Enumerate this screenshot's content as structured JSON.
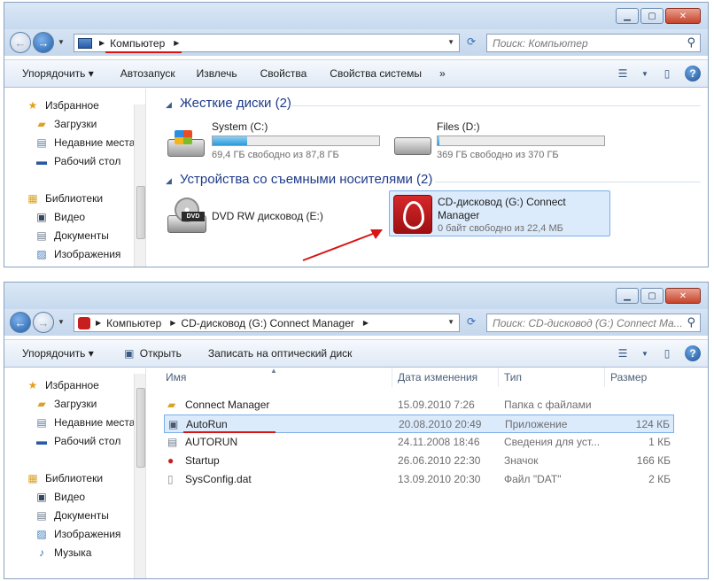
{
  "window1": {
    "address": {
      "crumbs": [
        "Компьютер"
      ]
    },
    "search_placeholder": "Поиск: Компьютер",
    "toolbar": {
      "organize": "Упорядочить ▾",
      "autorun": "Автозапуск",
      "eject": "Извлечь",
      "properties": "Свойства",
      "system_properties": "Свойства системы",
      "more": "»"
    },
    "sidebar": {
      "favorites": "Избранное",
      "downloads": "Загрузки",
      "recent": "Недавние места",
      "desktop": "Рабочий стол",
      "libraries": "Библиотеки",
      "video": "Видео",
      "documents": "Документы",
      "images": "Изображения"
    },
    "hard_drives": {
      "header": "Жесткие диски (2)",
      "items": [
        {
          "name": "System (C:)",
          "free": "69,4 ГБ свободно из 87,8 ГБ",
          "used_fraction": 0.21
        },
        {
          "name": "Files (D:)",
          "free": "369 ГБ свободно из 370 ГБ",
          "used_fraction": 0.003
        }
      ]
    },
    "removable": {
      "header": "Устройства со съемными носителями (2)",
      "dvd": {
        "name": "DVD RW дисковод (E:)"
      },
      "cd": {
        "name_line1": "CD-дисковод (G:) Connect",
        "name_line2": "Manager",
        "free": "0 байт свободно из 22,4 МБ"
      }
    },
    "dvd_icon_label": "DVD"
  },
  "window2": {
    "address": {
      "crumbs": [
        "Компьютер",
        "CD-дисковод (G:) Connect Manager"
      ]
    },
    "search_placeholder": "Поиск: CD-дисковод (G:) Connect Ma...",
    "toolbar": {
      "organize": "Упорядочить ▾",
      "open": "Открыть",
      "burn": "Записать на оптический диск"
    },
    "sidebar": {
      "favorites": "Избранное",
      "downloads": "Загрузки",
      "recent": "Недавние места",
      "desktop": "Рабочий стол",
      "libraries": "Библиотеки",
      "video": "Видео",
      "documents": "Документы",
      "images": "Изображения",
      "music": "Музыка"
    },
    "columns": {
      "name": "Имя",
      "date": "Дата изменения",
      "type": "Тип",
      "size": "Размер"
    },
    "files": [
      {
        "name": "Connect Manager",
        "date": "15.09.2010 7:26",
        "type": "Папка с файлами",
        "size": ""
      },
      {
        "name": "AutoRun",
        "date": "20.08.2010 20:49",
        "type": "Приложение",
        "size": "124 КБ"
      },
      {
        "name": "AUTORUN",
        "date": "24.11.2008 18:46",
        "type": "Сведения для уст...",
        "size": "1 КБ"
      },
      {
        "name": "Startup",
        "date": "26.06.2010 22:30",
        "type": "Значок",
        "size": "166 КБ"
      },
      {
        "name": "SysConfig.dat",
        "date": "13.09.2010 20:30",
        "type": "Файл \"DAT\"",
        "size": "2 КБ"
      }
    ]
  },
  "colors": {
    "accent_red": "#d81414",
    "header_blue": "#1e3b8a",
    "selection": "#dcebfc"
  }
}
